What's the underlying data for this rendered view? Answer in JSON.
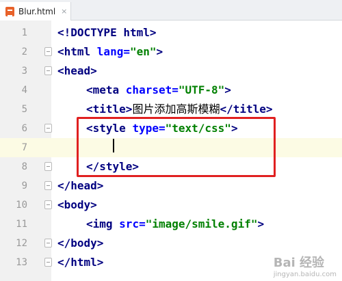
{
  "tab": {
    "filename": "Blur.html",
    "close": "×"
  },
  "lines": [
    {
      "no": "1"
    },
    {
      "no": "2"
    },
    {
      "no": "3"
    },
    {
      "no": "4"
    },
    {
      "no": "5"
    },
    {
      "no": "6"
    },
    {
      "no": "7"
    },
    {
      "no": "8"
    },
    {
      "no": "9"
    },
    {
      "no": "10"
    },
    {
      "no": "11"
    },
    {
      "no": "12"
    },
    {
      "no": "13"
    }
  ],
  "code": {
    "l1": {
      "a": "<!DOCTYPE ",
      "b": "html",
      "c": ">"
    },
    "l2": {
      "open": "<html ",
      "attr": "lang=",
      "val": "\"en\"",
      "close": ">"
    },
    "l3": {
      "tag": "<head>"
    },
    "l4": {
      "open": "<meta ",
      "attr": "charset=",
      "val": "\"UTF-8\"",
      "close": ">"
    },
    "l5": {
      "open": "<title>",
      "text": "图片添加高斯模糊",
      "close": "</title>"
    },
    "l6": {
      "open": "<style ",
      "attr": "type=",
      "val": "\"text/css\"",
      "close": ">"
    },
    "l8": {
      "tag": "</style>"
    },
    "l9": {
      "tag": "</head>"
    },
    "l10": {
      "tag": "<body>"
    },
    "l11": {
      "open": "<img ",
      "attr": "src=",
      "val": "\"image/smile.gif\"",
      "close": ">"
    },
    "l12": {
      "tag": "</body>"
    },
    "l13": {
      "tag": "</html>"
    }
  },
  "watermark": {
    "brand": "Bai 经验",
    "url": "jingyan.baidu.com"
  },
  "colors": {
    "highlight": "#e02020",
    "tag": "#000080",
    "attr": "#0000ff",
    "string": "#008000"
  }
}
